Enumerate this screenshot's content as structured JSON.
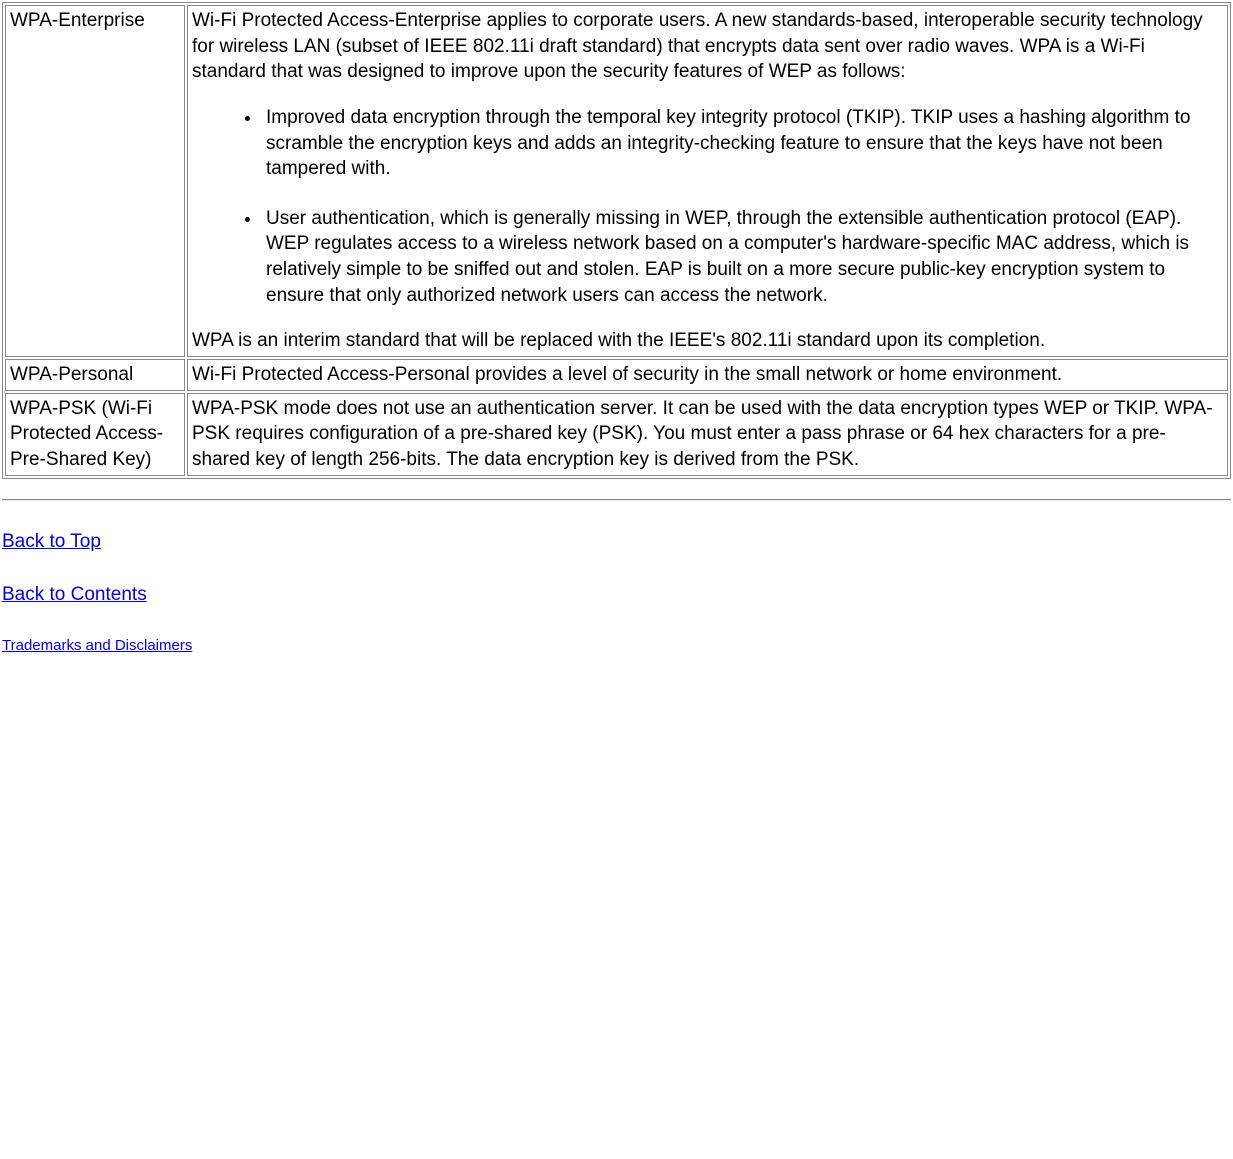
{
  "rows": [
    {
      "term": "WPA-Enterprise",
      "intro": "Wi-Fi Protected Access-Enterprise applies to corporate users. A new standards-based, interoperable security technology for wireless LAN (subset of IEEE 802.11i draft standard) that encrypts data sent over radio waves. WPA is a Wi-Fi standard that was designed to improve upon the security features of WEP as follows:",
      "bullets": [
        "Improved data encryption through the temporal key integrity protocol (TKIP). TKIP uses a hashing algorithm to scramble the encryption keys and adds an integrity-checking feature to ensure that the keys have not been tampered with.",
        "User authentication, which is generally missing in WEP, through the extensible authentication protocol (EAP). WEP regulates access to a wireless network based on a computer's hardware-specific MAC address, which is relatively simple to be sniffed out and stolen. EAP is built on a more secure public-key encryption system to ensure that only authorized network users can access the network."
      ],
      "outro": "WPA is an interim standard that will be replaced with the IEEE's 802.11i standard upon its completion."
    },
    {
      "term": "WPA-Personal",
      "desc": "Wi-Fi Protected Access-Personal provides a level of security in the small network or home environment."
    },
    {
      "term": "WPA-PSK (Wi-Fi Protected Access-Pre-Shared Key)",
      "desc": "WPA-PSK mode does not use an authentication server. It can be used with the data encryption types WEP or TKIP. WPA-PSK requires configuration of a pre-shared key (PSK). You must enter a pass phrase or 64 hex characters for a pre-shared key of length 256-bits. The data encryption key is derived from the PSK."
    }
  ],
  "links": {
    "back_to_top": "Back to Top",
    "back_to_contents": "Back to Contents",
    "trademarks": "Trademarks and Disclaimers"
  }
}
